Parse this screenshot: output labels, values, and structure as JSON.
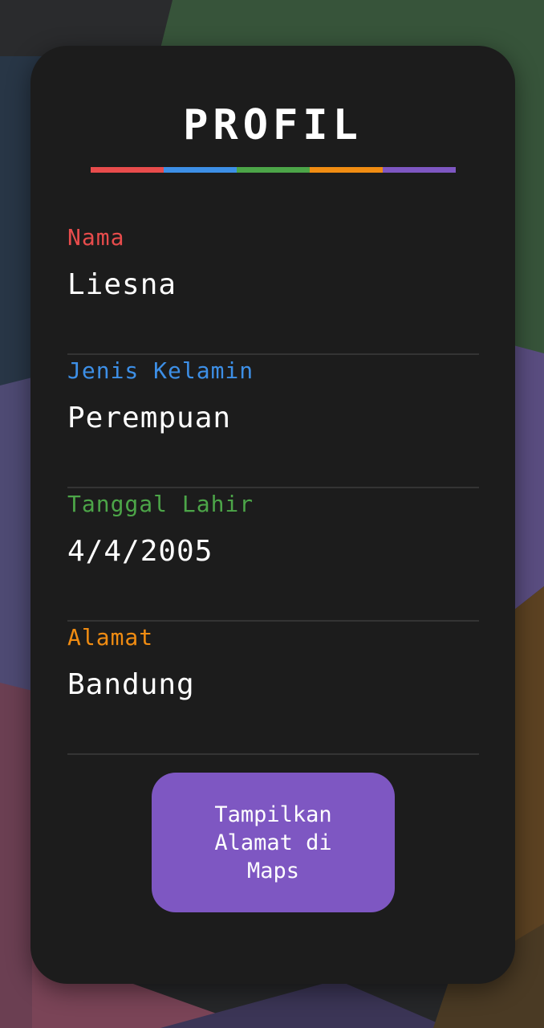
{
  "colors": {
    "card_bg": "#1c1c1c",
    "divider": "#343434",
    "text": "#ffffff",
    "red": "#e84c4c",
    "blue": "#3d8fe6",
    "green": "#4ca548",
    "orange": "#f08c12",
    "purple": "#7e57c2"
  },
  "profile": {
    "title": "PROFIL",
    "underline_colors": [
      "#e84c4c",
      "#3d8fe6",
      "#4ca548",
      "#f08c12",
      "#7e57c2"
    ],
    "fields": [
      {
        "label": "Nama",
        "value": "Liesna",
        "color": "#e84c4c"
      },
      {
        "label": "Jenis Kelamin",
        "value": "Perempuan",
        "color": "#3d8fe6"
      },
      {
        "label": "Tanggal Lahir",
        "value": "4/4/2005",
        "color": "#4ca548"
      },
      {
        "label": "Alamat",
        "value": "Bandung",
        "color": "#f08c12"
      }
    ],
    "maps_button_label": "Tampilkan Alamat di Maps",
    "maps_button_color": "#7e57c2"
  }
}
